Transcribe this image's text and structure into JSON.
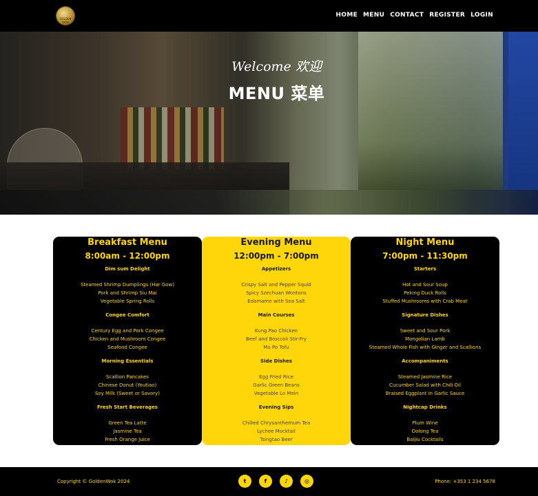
{
  "nav": {
    "logo_text": "GOLDEN WOK",
    "links": [
      "HOME",
      "MENU",
      "CONTACT",
      "REGISTER",
      "LOGIN"
    ]
  },
  "hero": {
    "welcome": "Welcome 欢迎",
    "title": "MENU 菜单"
  },
  "menus": [
    {
      "title": "Breakfast Menu",
      "hours": "8:00am - 12:00pm",
      "sections": [
        {
          "name": "Dim sum Delight",
          "items": [
            "Steamed Shrimp Dumplings (Har Gow)",
            "Pork and Shrimp Siu Mai",
            "Vegetable Spring Rolls"
          ]
        },
        {
          "name": "Congee Comfort",
          "items": [
            "Century Egg and Pork Congee",
            "Chicken and Mushroom Congee",
            "Seafood Congee"
          ]
        },
        {
          "name": "Morning Essentials",
          "items": [
            "Scallion Pancakes",
            "Chinese Donut (Youtiao)",
            "Soy Milk (Sweet or Savory)"
          ]
        },
        {
          "name": "Fresh Start Beverages",
          "items": [
            "Green Tea Latte",
            "Jasmine Tea",
            "Fresh Orange Juice"
          ]
        }
      ]
    },
    {
      "title": "Evening Menu",
      "hours": "12:00pm - 7:00pm",
      "sections": [
        {
          "name": "Appetizers",
          "items": [
            "Crispy Salt and Pepper Squid",
            "Spicy Szechuan Wontons",
            "Edamame with Sea Salt"
          ]
        },
        {
          "name": "Main Courses",
          "items": [
            "Kung Pao Chicken",
            "Beef and Broccoli Stir-Fry",
            "Ma Po Tofu"
          ]
        },
        {
          "name": "Side Dishes",
          "items": [
            "Egg Fried Rice",
            "Garlic Green Beans",
            "Vegetable Lo Mein"
          ]
        },
        {
          "name": "Evening Sips",
          "items": [
            "Chilled Chrysanthemum Tea",
            "Lychee Mocktail",
            "Tsingtao Beer"
          ]
        }
      ]
    },
    {
      "title": "Night Menu",
      "hours": "7:00pm - 11:30pm",
      "sections": [
        {
          "name": "Starters",
          "items": [
            "Hot and Sour Soup",
            "Peking Duck Rolls",
            "Stuffed Mushrooms with Crab Meat"
          ]
        },
        {
          "name": "Signature Dishes",
          "items": [
            "Sweet and Sour Pork",
            "Mongolian Lamb",
            "Steamed Whole Fish with Ginger and Scallions"
          ]
        },
        {
          "name": "Accompaniments",
          "items": [
            "Steamed Jasmine Rice",
            "Cucumber Salad with Chili Oil",
            "Braised Eggplant in Garlic Sauce"
          ]
        },
        {
          "name": "Nightcap Drinks",
          "items": [
            "Plum Wine",
            "Oolong Tea",
            "Baijiu Cocktails"
          ]
        }
      ]
    }
  ],
  "footer": {
    "copyright": "Copyright © GoldenWok 2024",
    "phone": "Phone: +353 1 234 5678",
    "socials": [
      {
        "icon": "twitter-icon",
        "glyph": "t"
      },
      {
        "icon": "facebook-icon",
        "glyph": "f"
      },
      {
        "icon": "tiktok-icon",
        "glyph": "♪"
      },
      {
        "icon": "instagram-icon",
        "glyph": "◎"
      }
    ]
  },
  "colors": {
    "accent": "#ffd60a",
    "dark": "#000000"
  }
}
